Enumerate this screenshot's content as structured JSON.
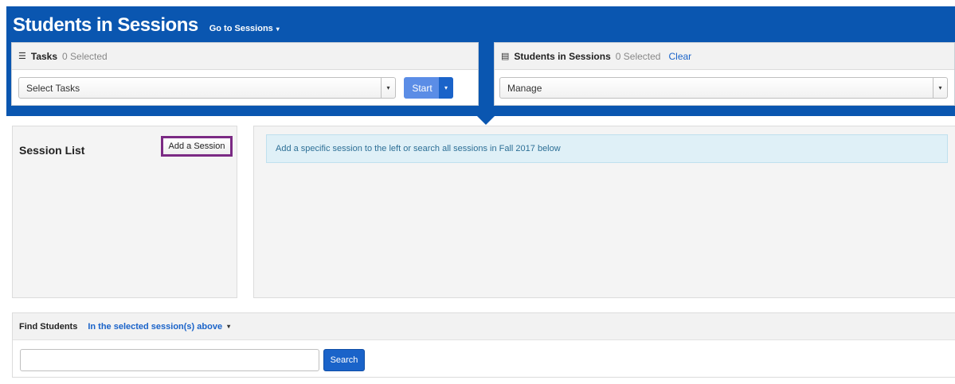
{
  "header": {
    "title": "Students in Sessions",
    "goto_label": "Go to Sessions",
    "goto_caret": "▾"
  },
  "tasks_panel": {
    "icon": "list-icon",
    "icon_glyph": "☰",
    "label": "Tasks",
    "count": "0 Selected",
    "select_value": "Select Tasks",
    "select_caret": "▾",
    "start_label": "Start",
    "start_caret": "▾"
  },
  "sis_panel": {
    "icon": "calendar-icon",
    "icon_glyph": "▤",
    "label": "Students in Sessions",
    "count": "0 Selected",
    "clear_label": "Clear",
    "select_value": "Manage",
    "select_caret": "▾"
  },
  "session_list": {
    "title": "Session List",
    "add_button": "Add a Session"
  },
  "main": {
    "info_text": "Add a specific session to the left or search all sessions in Fall 2017 below"
  },
  "find_students": {
    "label": "Find Students",
    "scope": "In the selected session(s) above",
    "scope_caret": "▾",
    "input_value": "",
    "search_button": "Search"
  },
  "colors": {
    "header_blue": "#0a56b0",
    "link_blue": "#1a63c9",
    "start_blue": "#5b8de6",
    "highlight_purple": "#7b2a84",
    "info_bg": "#dff0f7"
  }
}
